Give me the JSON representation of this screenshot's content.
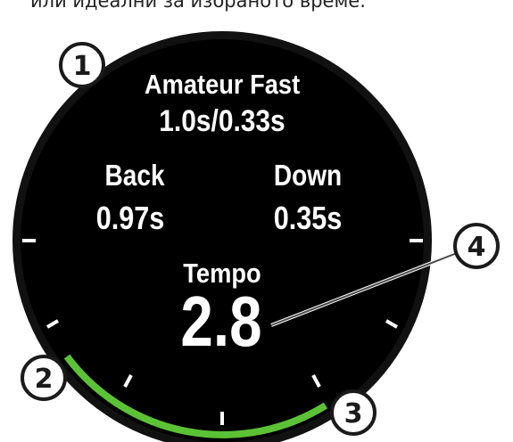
{
  "caption": {
    "text": "или идеални за избраното време."
  },
  "watch_screen": {
    "preset_name": "Amateur Fast",
    "target_ratio": "1.0s/0.33s",
    "back_label": "Back",
    "back_value": "0.97s",
    "down_label": "Down",
    "down_value": "0.35s",
    "tempo_label": "Tempo",
    "tempo_value": "2.8"
  },
  "callouts": [
    {
      "number": "1"
    },
    {
      "number": "2"
    },
    {
      "number": "3"
    },
    {
      "number": "4"
    }
  ],
  "colors": {
    "bezel": "#111111",
    "screen": "#000000",
    "range_arc": "#5bc236",
    "text": "#ffffff"
  }
}
